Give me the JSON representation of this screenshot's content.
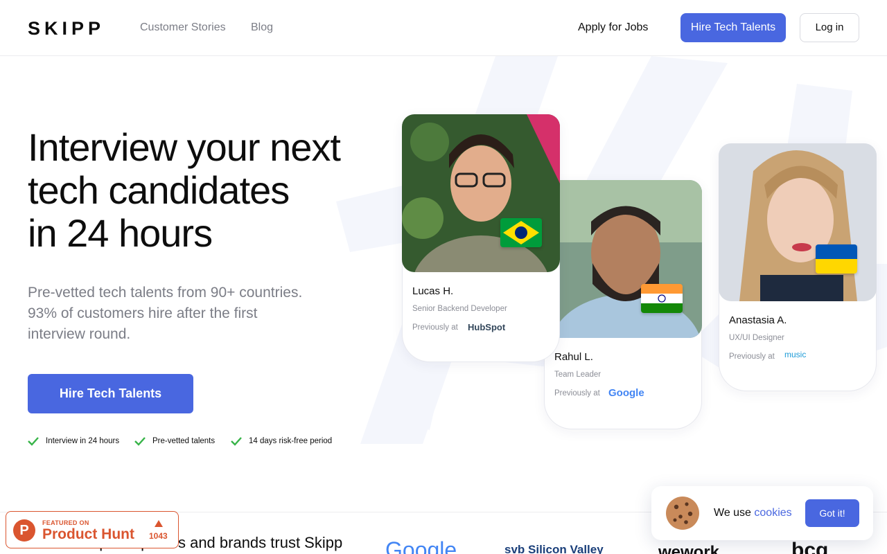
{
  "header": {
    "logo": "SKIPP",
    "nav": [
      {
        "label": "Customer Stories"
      },
      {
        "label": "Blog"
      }
    ],
    "apply_label": "Apply for Jobs",
    "hire_label": "Hire Tech Talents",
    "login_label": "Log in"
  },
  "hero": {
    "title_line1": "Interview your next",
    "title_line2": "tech candidates",
    "title_line3": "in 24 hours",
    "subtitle_line1": "Pre-vetted tech talents from 90+ countries.",
    "subtitle_line2": "93% of customers hire after the first",
    "subtitle_line3": "interview round.",
    "cta_label": "Hire Tech Talents",
    "features": [
      {
        "label": "Interview in 24 hours"
      },
      {
        "label": "Pre-vetted talents"
      },
      {
        "label": "14 days risk-free period"
      }
    ]
  },
  "candidates": [
    {
      "name": "Lucas H.",
      "role": "Senior Backend Developer",
      "previously": "Previously at",
      "company": "HubSpot",
      "flag": "brazil-flag"
    },
    {
      "name": "Rahul L.",
      "role": "Team Leader",
      "previously": "Previously at",
      "company": "Google",
      "flag": "india-flag"
    },
    {
      "name": "Anastasia A.",
      "role": "UX/UI Designer",
      "previously": "Previously at",
      "company": "music",
      "flag": "ukraine-flag"
    }
  ],
  "trust": {
    "text": "Top companies and brands trust Skipp",
    "brands": [
      {
        "label": "Google"
      },
      {
        "label": "svb Silicon Valley"
      },
      {
        "label": "wework"
      },
      {
        "label": "bcg"
      }
    ]
  },
  "product_hunt": {
    "featured": "FEATURED ON",
    "name": "Product Hunt",
    "count": "1043"
  },
  "cookie": {
    "text": "We use",
    "link": "cookies",
    "button": "Got it!"
  },
  "colors": {
    "accent": "#4967e0",
    "text": "#0d0d0d",
    "muted": "#7b7d86",
    "product_hunt": "#da552f"
  }
}
